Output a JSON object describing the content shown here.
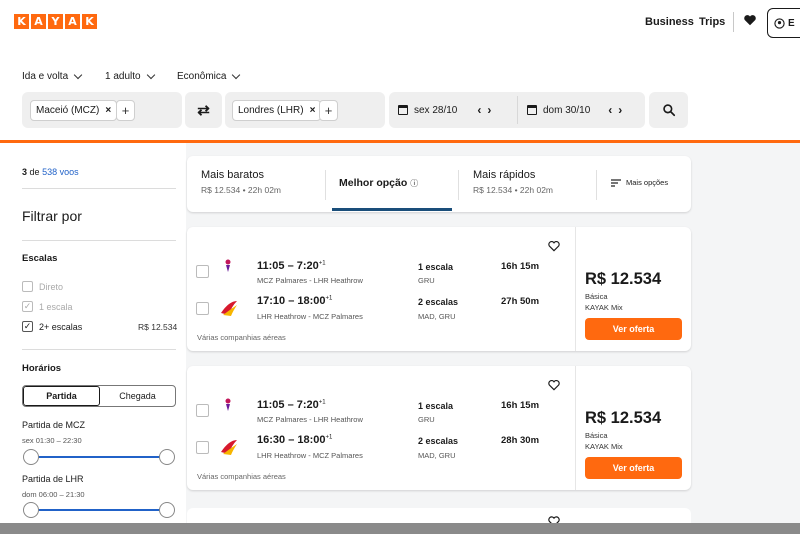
{
  "header": {
    "logo_letters": [
      "K",
      "A",
      "Y",
      "A",
      "K"
    ],
    "nav": {
      "business": "Business",
      "trips": "Trips"
    },
    "signin_label": "E"
  },
  "search": {
    "trip_type": "Ida e volta",
    "passengers": "1 adulto",
    "cabin": "Econômica",
    "origin": "Maceió (MCZ)",
    "destination": "Londres (LHR)",
    "depart_date": "sex 28/10",
    "return_date": "dom 30/10",
    "clear_glyph": "×",
    "add_glyph": "+",
    "prev_glyph": "‹",
    "next_glyph": "›",
    "swap_glyph": "⇄"
  },
  "sidebar": {
    "count_num": "3",
    "count_of": "de",
    "count_total": "538 voos",
    "filter_title": "Filtrar por",
    "stops_title": "Escalas",
    "stops": [
      {
        "label": "Direto",
        "price": "",
        "checked": false,
        "disabled": true
      },
      {
        "label": "1 escala",
        "price": "",
        "checked": true,
        "disabled": true
      },
      {
        "label": "2+ escalas",
        "price": "R$ 12.534",
        "checked": true,
        "disabled": false
      }
    ],
    "check_glyph": "✓",
    "times_title": "Horários",
    "toggle": {
      "left": "Partida",
      "right": "Chegada"
    },
    "time_filters": [
      {
        "label": "Partida de MCZ",
        "range": "sex 01:30 – 22:30"
      },
      {
        "label": "Partida de LHR",
        "range": "dom 06:00 – 21:30"
      }
    ]
  },
  "tabs": [
    {
      "title": "Mais baratos",
      "sub": "R$ 12.534 • 22h 02m"
    },
    {
      "title": "Melhor opção",
      "sub": "",
      "info_glyph": "ⓘ"
    },
    {
      "title": "Mais rápidos",
      "sub": "R$ 12.534 • 22h 02m"
    },
    {
      "title": "Mais opções",
      "sub": ""
    }
  ],
  "results": [
    {
      "legs": [
        {
          "time": "11:05 – 7:20",
          "plus": "+1",
          "route": "MCZ Palmares - LHR Heathrow",
          "stops": "1 escala",
          "via": "GRU",
          "duration": "16h 15m"
        },
        {
          "time": "17:10 – 18:00",
          "plus": "+1",
          "route": "LHR Heathrow - MCZ Palmares",
          "stops": "2 escalas",
          "via": "MAD, GRU",
          "duration": "27h 50m"
        }
      ],
      "airlines": "Várias companhias aéreas",
      "price": "R$ 12.534",
      "fare": "Básica",
      "provider": "KAYAK Mix",
      "cta": "Ver oferta"
    },
    {
      "legs": [
        {
          "time": "11:05 – 7:20",
          "plus": "+1",
          "route": "MCZ Palmares - LHR Heathrow",
          "stops": "1 escala",
          "via": "GRU",
          "duration": "16h 15m"
        },
        {
          "time": "16:30 – 18:00",
          "plus": "+1",
          "route": "LHR Heathrow - MCZ Palmares",
          "stops": "2 escalas",
          "via": "MAD, GRU",
          "duration": "28h 30m"
        }
      ],
      "airlines": "Várias companhias aéreas",
      "price": "R$ 12.534",
      "fare": "Básica",
      "provider": "KAYAK Mix",
      "cta": "Ver oferta"
    }
  ],
  "colors": {
    "accent": "#ff690f",
    "link": "#2162c8",
    "tab_underline": "#1a4e7a"
  }
}
